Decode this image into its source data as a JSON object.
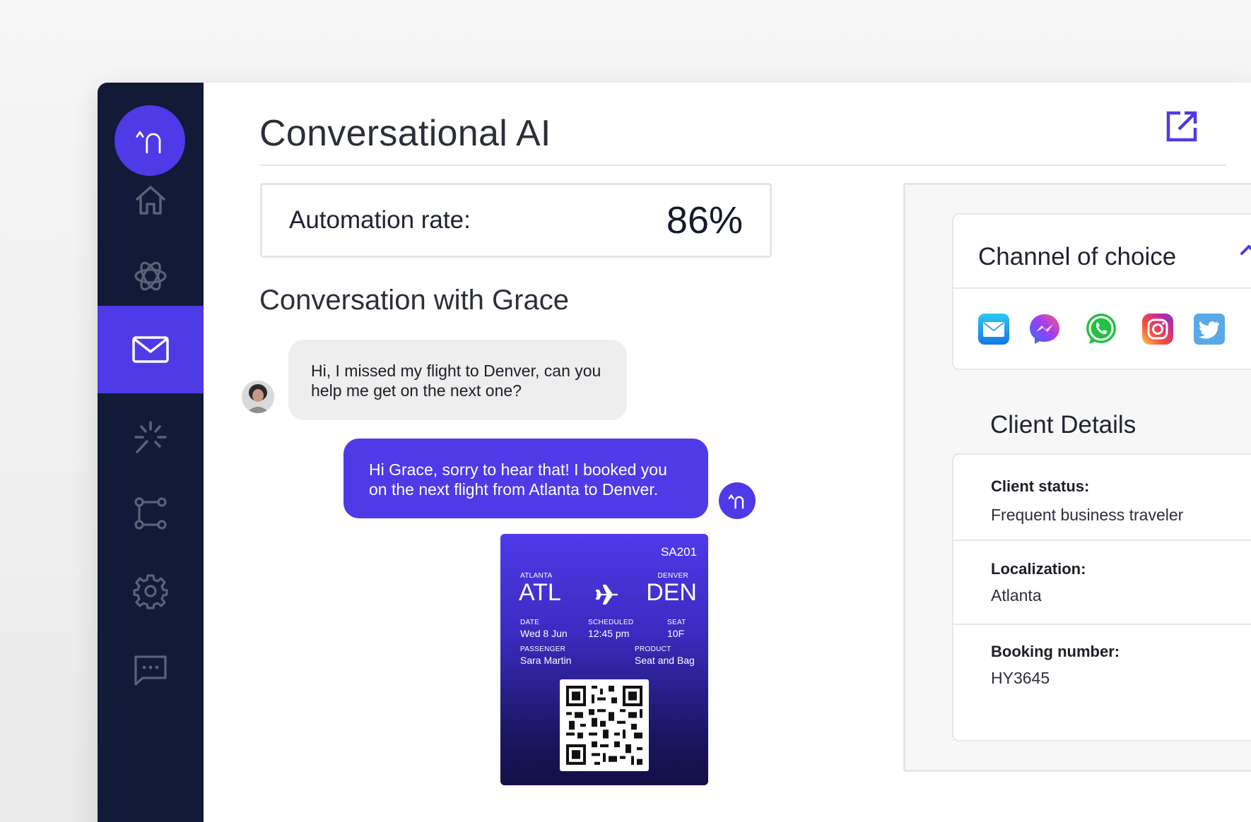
{
  "app": {
    "title": "Conversational AI"
  },
  "sidebar": {
    "items": [
      {
        "name": "home",
        "icon": "home-icon",
        "active": false
      },
      {
        "name": "ai",
        "icon": "atom-icon",
        "active": false
      },
      {
        "name": "messages",
        "icon": "mail-icon",
        "active": true
      },
      {
        "name": "automation",
        "icon": "sparkle-icon",
        "active": false
      },
      {
        "name": "flows",
        "icon": "flow-icon",
        "active": false
      },
      {
        "name": "settings",
        "icon": "gear-icon",
        "active": false
      },
      {
        "name": "chat",
        "icon": "chat-icon",
        "active": false
      }
    ]
  },
  "metric": {
    "label": "Automation rate:",
    "value": "86%"
  },
  "conversation": {
    "title": "Conversation with Grace",
    "messages": [
      {
        "from": "customer",
        "text": "Hi, I missed my flight to Denver, can you help me get on the next one?"
      },
      {
        "from": "bot",
        "text": "Hi Grace, sorry to hear that! I booked you on the next flight from Atlanta to Denver."
      }
    ]
  },
  "ticket": {
    "flight": "SA201",
    "from_city": "ATLANTA",
    "from_code": "ATL",
    "to_city": "DENVER",
    "to_code": "DEN",
    "date_label": "DATE",
    "date": "Wed 8 Jun",
    "scheduled_label": "SCHEDULED",
    "scheduled": "12:45 pm",
    "seat_label": "SEAT",
    "seat": "10F",
    "passenger_label": "PASSENGER",
    "passenger": "Sara Martin",
    "product_label": "PRODUCT",
    "product": "Seat and Bag"
  },
  "channels": {
    "title": "Channel of choice",
    "items": [
      "email-icon",
      "messenger-icon",
      "whatsapp-icon",
      "instagram-icon",
      "twitter-icon"
    ]
  },
  "client": {
    "title": "Client Details",
    "fields": [
      {
        "label": "Client status:",
        "value": "Frequent business traveler"
      },
      {
        "label": "Localization:",
        "value": "Atlanta"
      },
      {
        "label": "Booking number:",
        "value": "HY3645"
      }
    ]
  },
  "colors": {
    "accent": "#4f3ae8",
    "sidebar": "#111a36"
  }
}
